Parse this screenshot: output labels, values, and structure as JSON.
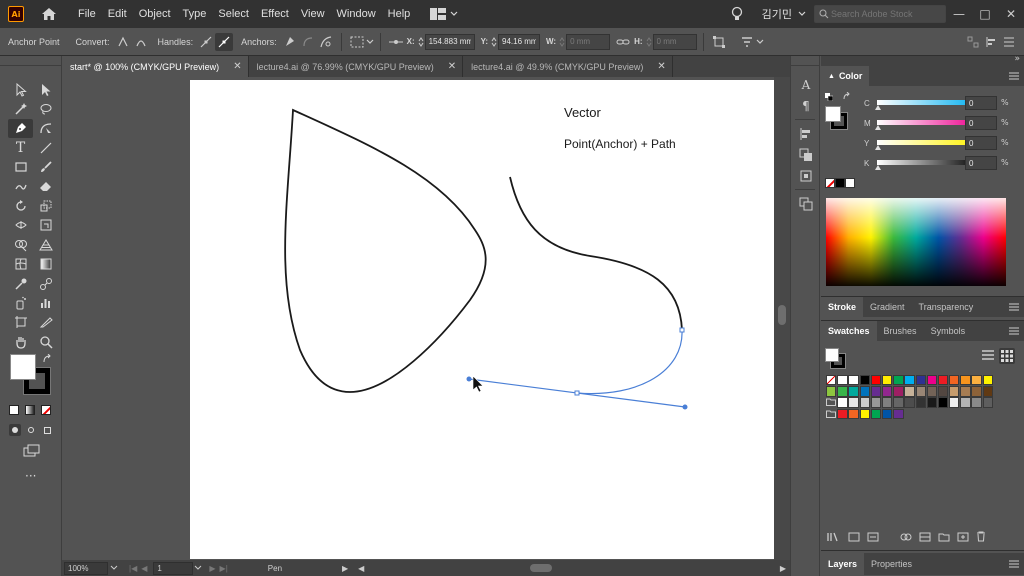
{
  "menubar": {
    "logo": "Ai",
    "menus": [
      "File",
      "Edit",
      "Object",
      "Type",
      "Select",
      "Effect",
      "View",
      "Window",
      "Help"
    ],
    "user": "김기민",
    "search_placeholder": "Search Adobe Stock"
  },
  "controlbar": {
    "tool_name": "Anchor Point",
    "convert_label": "Convert:",
    "handles_label": "Handles:",
    "anchors_label": "Anchors:",
    "x_label": "X:",
    "x_value": "154.883 mm",
    "y_label": "Y:",
    "y_value": "94.16 mm",
    "w_label": "W:",
    "w_value": "0 mm",
    "h_label": "H:",
    "h_value": "0 mm"
  },
  "tabs": [
    {
      "label": "start* @ 100% (CMYK/GPU Preview)",
      "active": true
    },
    {
      "label": "lecture4.ai @ 76.99% (CMYK/GPU Preview)",
      "active": false
    },
    {
      "label": "lecture4.ai @ 49.9% (CMYK/GPU Preview)",
      "active": false
    }
  ],
  "artboard": {
    "heading": "Vector",
    "subheading": "Point(Anchor) + Path",
    "text_color": "#1a1a1a",
    "path_color": "#1a1a1a",
    "selection_color": "#4a7fd6"
  },
  "statusbar": {
    "zoom": "100%",
    "artboard_index": "1",
    "tool": "Pen"
  },
  "color_panel": {
    "title": "Color",
    "channels": [
      {
        "label": "C",
        "value": "0",
        "unit": "%"
      },
      {
        "label": "M",
        "value": "0",
        "unit": "%"
      },
      {
        "label": "Y",
        "value": "0",
        "unit": "%"
      },
      {
        "label": "K",
        "value": "0",
        "unit": "%"
      }
    ]
  },
  "stroke_panel": {
    "tabs": [
      "Stroke",
      "Gradient",
      "Transparency"
    ]
  },
  "swatches_panel": {
    "tabs": [
      "Swatches",
      "Brushes",
      "Symbols"
    ],
    "rows": [
      [
        "#ffffff",
        "#ffffff",
        "#000000",
        "#ff0000",
        "#ffed00",
        "#00a651",
        "#00aeef",
        "#2e3192",
        "#ec008c",
        "#ed1c24",
        "#f26522",
        "#f7941d",
        "#fbb040",
        "#fff200"
      ],
      [
        "#8dc63f",
        "#39b54a",
        "#00a99d",
        "#0072bc",
        "#662d91",
        "#92278f",
        "#9e1f63",
        "#c7b299",
        "#998675",
        "#736357",
        "#534741",
        "#c69c6d",
        "#a67c52",
        "#8c6239",
        "#603913"
      ],
      [
        "#ffffff",
        "#e6e6e6",
        "#cccccc",
        "#999999",
        "#808080",
        "#666666",
        "#4d4d4d",
        "#333333",
        "#1a1a1a",
        "#000000",
        "#f0f0f0",
        "#b3b3b3",
        "#8a8a8a",
        "#5e5e5e"
      ],
      [
        "#ed1c24",
        "#f26522",
        "#fff200",
        "#00a651",
        "#0054a6",
        "#662d91"
      ]
    ]
  },
  "layers_panel": {
    "tabs": [
      "Layers",
      "Properties"
    ]
  }
}
